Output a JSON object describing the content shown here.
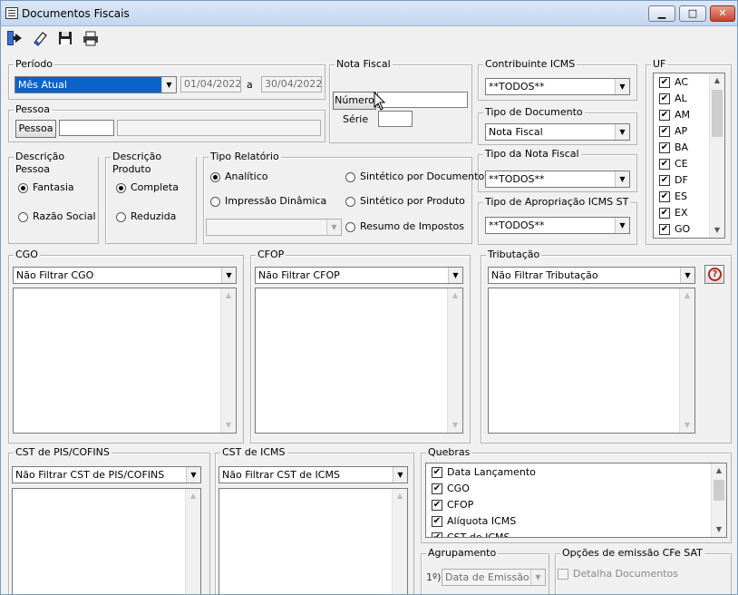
{
  "window": {
    "title": "Documentos Fiscais",
    "minimize": "▁",
    "maximize": "□",
    "close": "✕"
  },
  "toolbar": {
    "exit_icon": "exit-door-icon",
    "clear_icon": "eraser-icon",
    "save_icon": "floppy-disk-icon",
    "print_icon": "printer-icon"
  },
  "periodo": {
    "label": "Período",
    "selected": "Mês Atual",
    "date_from": "01/04/2022",
    "separator": "a",
    "date_to": "30/04/2022"
  },
  "nota_fiscal": {
    "label": "Nota Fiscal",
    "numero_button": "Número",
    "numero_value": "",
    "serie_label": "Série",
    "serie_value": ""
  },
  "pessoa": {
    "label": "Pessoa",
    "button": "Pessoa",
    "code": "",
    "name": ""
  },
  "contribuinte": {
    "label": "Contribuinte ICMS",
    "selected": "**TODOS**"
  },
  "tipo_documento": {
    "label": "Tipo de Documento",
    "selected": "Nota Fiscal"
  },
  "tipo_nota": {
    "label": "Tipo da Nota Fiscal",
    "selected": "**TODOS**"
  },
  "tipo_apropriacao": {
    "label": "Tipo de Apropriação ICMS ST",
    "selected": "**TODOS**"
  },
  "uf": {
    "label": "UF",
    "items": [
      {
        "code": "AC",
        "checked": true
      },
      {
        "code": "AL",
        "checked": true
      },
      {
        "code": "AM",
        "checked": true
      },
      {
        "code": "AP",
        "checked": true
      },
      {
        "code": "BA",
        "checked": true
      },
      {
        "code": "CE",
        "checked": true
      },
      {
        "code": "DF",
        "checked": true
      },
      {
        "code": "ES",
        "checked": true
      },
      {
        "code": "EX",
        "checked": true
      },
      {
        "code": "GO",
        "checked": true
      }
    ],
    "check_mark": "✔"
  },
  "descricao_pessoa": {
    "label": "Descrição Pessoa",
    "options": [
      "Fantasia",
      "Razão Social"
    ],
    "selected": 0
  },
  "descricao_produto": {
    "label": "Descrição Produto",
    "options": [
      "Completa",
      "Reduzida"
    ],
    "selected": 0
  },
  "tipo_relatorio": {
    "label": "Tipo Relatório",
    "options": [
      "Analítico",
      "Impressão Dinâmica",
      "Sintético por Documento",
      "Sintético por Produto",
      "Resumo de Impostos"
    ],
    "selected": 0,
    "dynamic_value": ""
  },
  "cgo": {
    "label": "CGO",
    "selected": "Não Filtrar CGO"
  },
  "cfop": {
    "label": "CFOP",
    "selected": "Não Filtrar CFOP"
  },
  "tributacao": {
    "label": "Tributação",
    "selected": "Não Filtrar Tributação",
    "help": "?"
  },
  "cst_pis": {
    "label": "CST de PIS/COFINS",
    "selected": "Não Filtrar CST de PIS/COFINS"
  },
  "cst_icms": {
    "label": "CST de ICMS",
    "selected": "Não Filtrar CST de ICMS"
  },
  "quebras": {
    "label": "Quebras",
    "items": [
      {
        "label": "Data Lançamento",
        "checked": true
      },
      {
        "label": "CGO",
        "checked": true
      },
      {
        "label": "CFOP",
        "checked": true
      },
      {
        "label": "Alíquota ICMS",
        "checked": true
      },
      {
        "label": "CST de ICMS",
        "checked": true
      }
    ]
  },
  "agrupamento": {
    "label": "Agrupamento",
    "ordinal": "1º)",
    "selected": "Data de Emissão"
  },
  "opcoes_cfe": {
    "label": "Opções de emissão CFe SAT",
    "detalha_label": "Detalha Documentos",
    "detalha_checked": false
  },
  "arrows": {
    "down": "▼",
    "up": "▲"
  }
}
